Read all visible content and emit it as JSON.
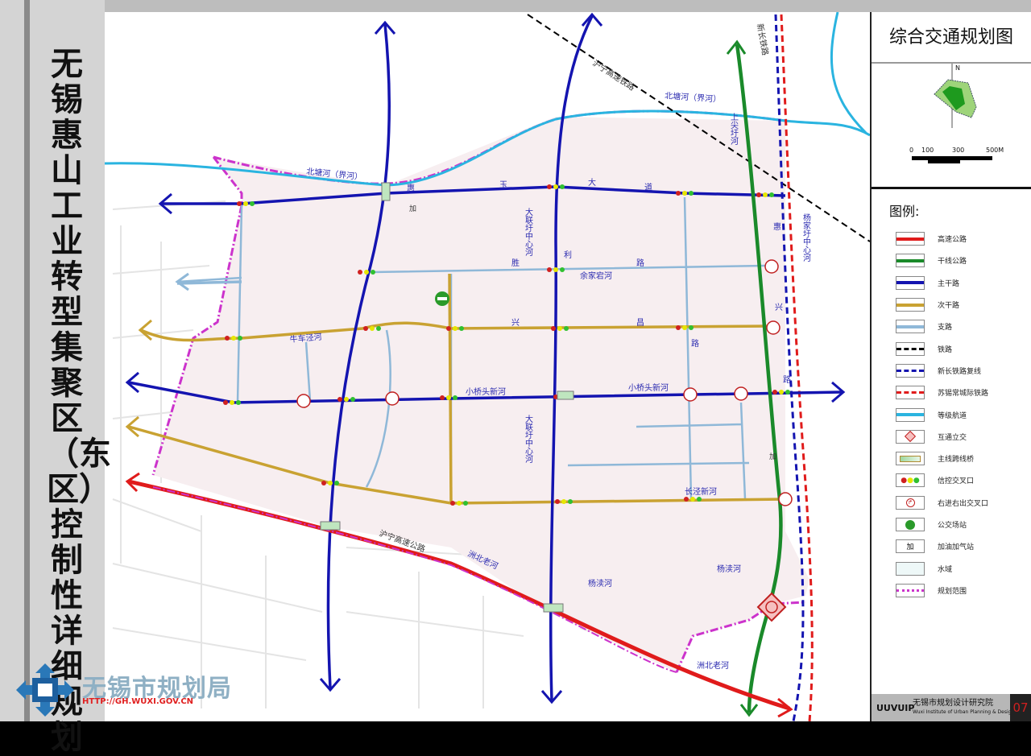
{
  "document_title": "无锡惠山工业转型集聚区（东区）控制性详细规划",
  "map_title": "综合交通规划图",
  "north_label": "N",
  "scale_labels": [
    "0",
    "100",
    "300",
    "500M"
  ],
  "legend": {
    "title": "图例:",
    "items": [
      {
        "label": "高速公路",
        "type": "line",
        "color": "#e01b1b"
      },
      {
        "label": "干线公路",
        "type": "line",
        "color": "#1a8a2a"
      },
      {
        "label": "主干路",
        "type": "line",
        "color": "#1414b0"
      },
      {
        "label": "次干路",
        "type": "line",
        "color": "#c9a232"
      },
      {
        "label": "支路",
        "type": "line",
        "color": "#8fb8d8"
      },
      {
        "label": "铁路",
        "type": "dash",
        "color": "#000000"
      },
      {
        "label": "新长铁路复线",
        "type": "dash",
        "color": "#1414b0"
      },
      {
        "label": "苏锡常城际铁路",
        "type": "dash",
        "color": "#e01b1b"
      },
      {
        "label": "等级航道",
        "type": "line",
        "color": "#2ab4e0"
      },
      {
        "label": "互通立交",
        "type": "interchange-icon"
      },
      {
        "label": "主线跨线桥",
        "type": "bridge-icon"
      },
      {
        "label": "信控交叉口",
        "type": "signal-icon"
      },
      {
        "label": "右进右出交叉口",
        "type": "right-turn-icon"
      },
      {
        "label": "公交场站",
        "type": "bus-icon"
      },
      {
        "label": "加油加气站",
        "type": "gas-icon",
        "symbol": "加"
      },
      {
        "label": "水域",
        "type": "area",
        "color": "#eef8f8"
      },
      {
        "label": "规划范围",
        "type": "dashdot",
        "color": "#cc33cc"
      }
    ]
  },
  "map_labels": {
    "river_north1": "北塘河（界河）",
    "river_north2": "北塘河（界河）",
    "railway": "沪宁高速铁路",
    "xinchang": "新长铁路",
    "huiyu": [
      "惠",
      "玉",
      "大",
      "道"
    ],
    "huixing": [
      "惠",
      "兴",
      "路"
    ],
    "shengli": [
      "胜",
      "利",
      "路"
    ],
    "xingchang": [
      "兴",
      "昌",
      "路"
    ],
    "xiaoqiao1": "小桥头新河",
    "xiaoqiao2": "小桥头新河",
    "expressway": "沪宁高速公路",
    "zhoubei1": "洲北老河",
    "zhoubei2": "洲北老河",
    "yangdu1": "杨渎河",
    "yangdu2": "杨渎河",
    "changjing": "长泾新河",
    "yujia": "余家宕河",
    "dalian1": "大联圩中心河",
    "dalian2": "大联圩中心河",
    "yangjia": "杨家圩中心河",
    "niuche": "牛车泾河",
    "shangjian": "上尖圩河",
    "gas": "加"
  },
  "logo": {
    "name": "无锡市规划局",
    "url": "HTTP://GH.WUXI.GOV.CN"
  },
  "footer": {
    "mark": "UUVUIP",
    "name": "无锡市规划设计研究院",
    "name_en": "Wuxi Institute of Urban Planning & Design",
    "page": "07"
  },
  "colors": {
    "expressway": "#e01b1b",
    "trunk": "#1a8a2a",
    "main": "#1414b0",
    "secondary": "#c9a232",
    "branch": "#8fb8d8",
    "river": "#2ab4e0",
    "boundary": "#cc33cc"
  }
}
